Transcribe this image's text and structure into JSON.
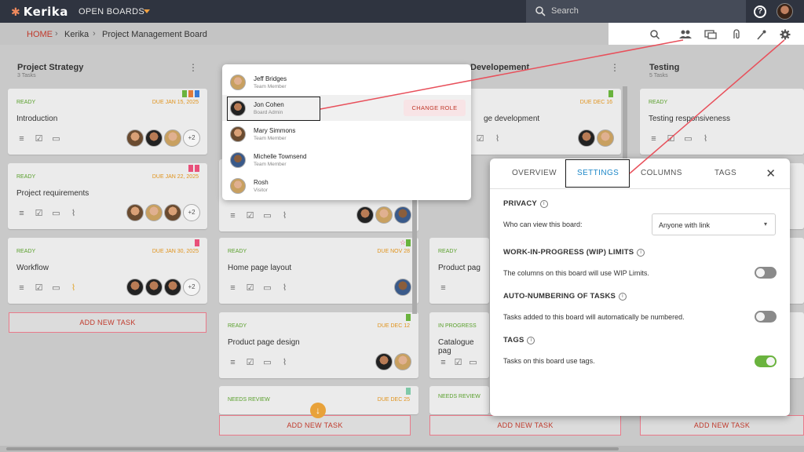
{
  "app": {
    "logo": "Kerika",
    "open_boards": "OPEN BOARDS",
    "search_placeholder": "Search"
  },
  "breadcrumb": {
    "home": "HOME",
    "level1": "Kerika",
    "level2": "Project Management Board"
  },
  "toolbar": {
    "icons": [
      "search-icon",
      "people-icon",
      "chat-icon",
      "attachment-icon",
      "wand-icon",
      "gear-icon"
    ]
  },
  "columns": [
    {
      "title": "Project Strategy",
      "count": "3 Tasks",
      "cards": [
        {
          "status": "READY",
          "due": "DUE JAN 15, 2025",
          "title": "Introduction",
          "more": "+2"
        },
        {
          "status": "READY",
          "due": "DUE JAN 22, 2025",
          "title": "Project requirements",
          "more": "+2"
        },
        {
          "status": "READY",
          "due": "DUE JAN 30, 2025",
          "title": "Workflow",
          "more": "+2"
        }
      ],
      "add_task": "ADD NEW TASK"
    },
    {
      "title": "",
      "count": "",
      "cards": [
        {
          "status": "READY",
          "due": "DUE NOV 28",
          "title": "Home page layout"
        },
        {
          "status": "READY",
          "due": "DUE DEC 12",
          "title": "Product page design"
        },
        {
          "status": "NEEDS REVIEW",
          "due": "DUE DEC 25",
          "title": ""
        }
      ],
      "add_task": "ADD NEW TASK"
    },
    {
      "title": "Developement",
      "count": "",
      "cards": [
        {
          "status": "",
          "due": "DUE DEC 16",
          "title": "ge development"
        },
        {
          "status": "READY",
          "due": "",
          "title": "Product pag"
        },
        {
          "status": "IN PROGRESS",
          "due": "",
          "title": "Catalogue pag"
        },
        {
          "status": "NEEDS REVIEW",
          "due": "",
          "title": ""
        }
      ],
      "add_task": "ADD NEW TASK"
    },
    {
      "title": "Testing",
      "count": "5 Tasks",
      "cards": [
        {
          "status": "READY",
          "due": "",
          "title": "Testing responsiveness"
        }
      ],
      "add_task": "ADD NEW TASK"
    }
  ],
  "people_popup": {
    "members": [
      {
        "name": "Jeff Bridges",
        "role": "Team Member"
      },
      {
        "name": "Jon Cohen",
        "role": "Board Admin"
      },
      {
        "name": "Mary Simmons",
        "role": "Team Member"
      },
      {
        "name": "Michelle Townsend",
        "role": "Team Member"
      },
      {
        "name": "Rosh",
        "role": "Visitor"
      }
    ],
    "change_role": "CHANGE ROLE"
  },
  "settings": {
    "tabs": [
      "OVERVIEW",
      "SETTINGS",
      "COLUMNS",
      "TAGS"
    ],
    "active_tab": "SETTINGS",
    "privacy_title": "PRIVACY",
    "privacy_label": "Who can view this board:",
    "privacy_value": "Anyone with link",
    "wip_title": "WORK-IN-PROGRESS (WIP) LIMITS",
    "wip_text": "The columns on this board will use WIP Limits.",
    "wip_enabled": false,
    "autonum_title": "AUTO-NUMBERING OF TASKS",
    "autonum_text": "Tasks added to this board will automatically be numbered.",
    "autonum_enabled": false,
    "tags_title": "TAGS",
    "tags_text": "Tasks on this board use tags.",
    "tags_enabled": true
  },
  "colors": {
    "accent": "#c0392b",
    "ready": "#5aa02c",
    "due": "#e0931c",
    "active_tab": "#1e88c8",
    "toggle_on": "#6ab33e",
    "annotation": "#e8505b"
  }
}
